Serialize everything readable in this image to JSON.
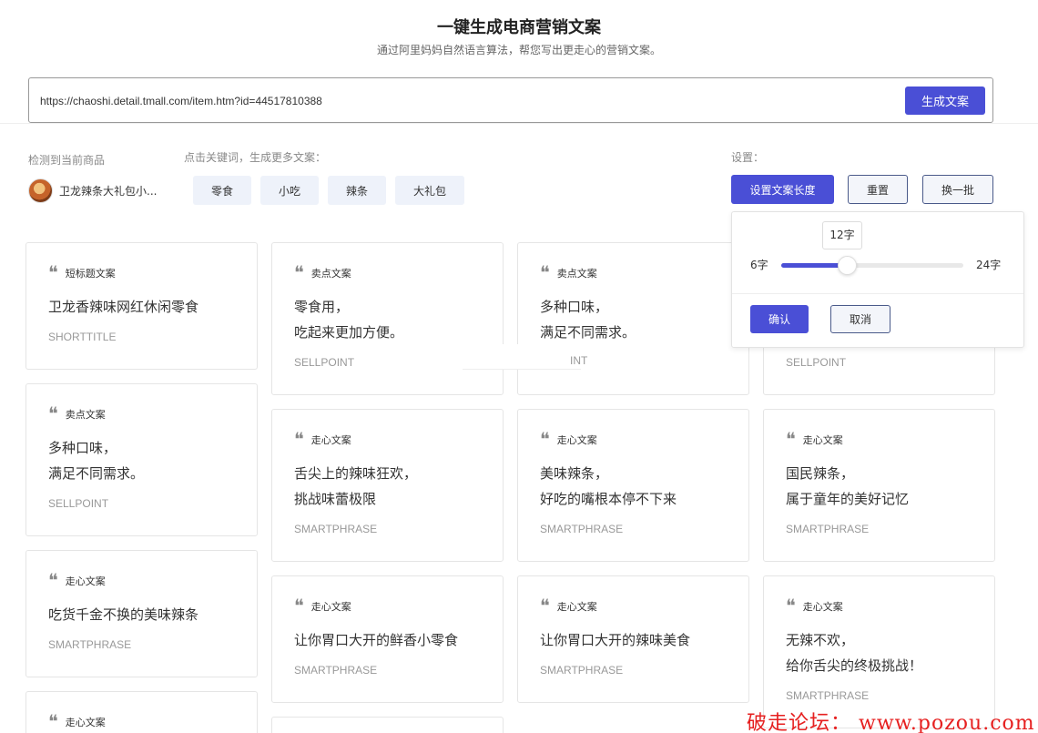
{
  "header": {
    "title": "一键生成电商营销文案",
    "subtitle": "通过阿里妈妈自然语言算法，帮您写出更走心的营销文案。",
    "url_value": "https://chaoshi.detail.tmall.com/item.htm?id=44517810388",
    "generate_label": "生成文案"
  },
  "product": {
    "label": "检测到当前商品",
    "name": "卫龙辣条大礼包小..."
  },
  "keywords": {
    "label": "点击关键词，生成更多文案：",
    "items": [
      "零食",
      "小吃",
      "辣条",
      "大礼包"
    ]
  },
  "settings": {
    "label": "设置：",
    "length_label": "设置文案长度",
    "reset_label": "重置",
    "refresh_label": "换一批"
  },
  "popup": {
    "min_label": "6字",
    "max_label": "24字",
    "current_label": "12字",
    "min": 6,
    "max": 24,
    "value": 12,
    "confirm_label": "确认",
    "cancel_label": "取消"
  },
  "cards": [
    {
      "tag": "短标题文案",
      "lines": [
        "卫龙香辣味网红休闲零食"
      ],
      "type": "SHORTTITLE"
    },
    {
      "tag": "卖点文案",
      "lines": [
        "多种口味，",
        "满足不同需求。"
      ],
      "type": "SELLPOINT"
    },
    {
      "tag": "走心文案",
      "lines": [
        "吃货千金不换的美味辣条"
      ],
      "type": "SMARTPHRASE"
    },
    {
      "tag": "走心文案",
      "lines": [],
      "type": ""
    },
    {
      "tag": "卖点文案",
      "lines": [
        "零食用，",
        "吃起来更加方便。"
      ],
      "type": "SELLPOINT"
    },
    {
      "tag": "走心文案",
      "lines": [
        "舌尖上的辣味狂欢，",
        "挑战味蕾极限"
      ],
      "type": "SMARTPHRASE"
    },
    {
      "tag": "走心文案",
      "lines": [
        "让你胃口大开的鲜香小零食"
      ],
      "type": "SMARTPHRASE"
    },
    {
      "tag": "卖点文案",
      "lines": [
        "多种口味，",
        "满足不同需求。"
      ],
      "type": "SELLPOINT"
    },
    {
      "tag": "走心文案",
      "lines": [
        "美味辣条，",
        "好吃的嘴根本停不下来"
      ],
      "type": "SMARTPHRASE"
    },
    {
      "tag": "走心文案",
      "lines": [
        "让你胃口大开的辣味美食"
      ],
      "type": "SMARTPHRASE"
    },
    {
      "tag": "",
      "lines": [],
      "type": "SELLPOINT"
    },
    {
      "tag": "走心文案",
      "lines": [
        "国民辣条，",
        "属于童年的美好记忆"
      ],
      "type": "SMARTPHRASE"
    },
    {
      "tag": "走心文案",
      "lines": [
        "无辣不欢，",
        "给你舌尖的终极挑战！"
      ],
      "type": "SMARTPHRASE"
    }
  ],
  "artifact_text": "INT",
  "watermark": "破走论坛： www.pozou.com"
}
